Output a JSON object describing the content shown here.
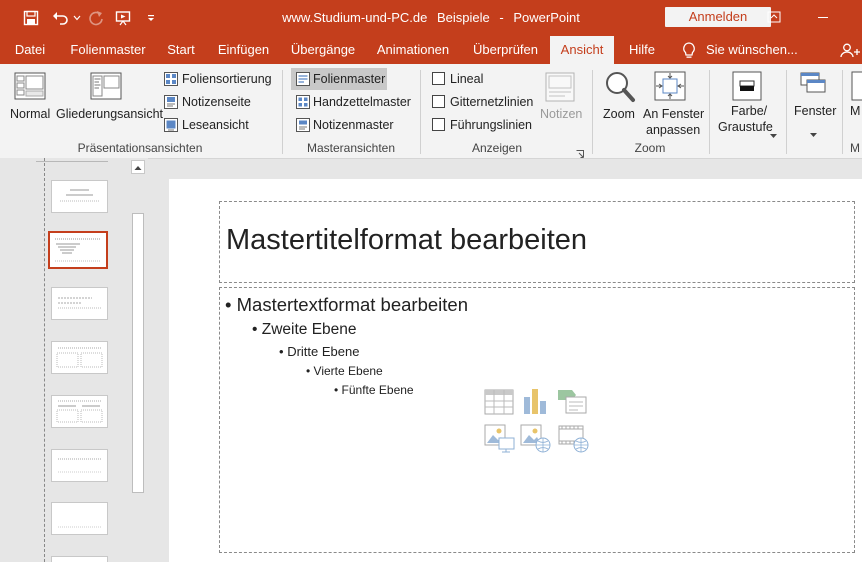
{
  "window": {
    "title_site": "www.Studium-und-PC.de",
    "title_doc": "Beispiele",
    "title_sep": "-",
    "title_app": "PowerPoint",
    "signin_label": "Anmelden"
  },
  "tabs": [
    "Datei",
    "Folienmaster",
    "Start",
    "Einfügen",
    "Übergänge",
    "Animationen",
    "Überprüfen",
    "Ansicht",
    "Hilfe"
  ],
  "active_tab": "Ansicht",
  "tell_me": "Sie wünschen...",
  "ribbon": {
    "presentation_views": {
      "group_label": "Präsentationsansichten",
      "normal": "Normal",
      "outline": "Gliederungsansicht",
      "slide_sorter": "Foliensortierung",
      "notes_page": "Notizenseite",
      "reading_view": "Leseansicht"
    },
    "master_views": {
      "group_label": "Masteransichten",
      "slide_master": "Folienmaster",
      "handout_master": "Handzettelmaster",
      "notes_master": "Notizenmaster"
    },
    "show": {
      "group_label": "Anzeigen",
      "ruler": "Lineal",
      "gridlines": "Gitternetzlinien",
      "guides": "Führungslinien",
      "notes": "Notizen"
    },
    "zoom": {
      "group_label": "Zoom",
      "zoom": "Zoom",
      "fit_line1": "An Fenster",
      "fit_line2": "anpassen"
    },
    "color": {
      "line1": "Farbe/",
      "line2": "Graustufe"
    },
    "window": {
      "label": "Fenster"
    }
  },
  "slide": {
    "title": "Mastertitelformat bearbeiten",
    "level1": "Mastertextformat bearbeiten",
    "level2": "Zweite Ebene",
    "level3": "Dritte Ebene",
    "level4": "Vierte Ebene",
    "level5": "Fünfte Ebene",
    "bullet": "•"
  },
  "colors": {
    "accent": "#c43e1c",
    "ribbon_bg": "#f3f3f3",
    "workspace_bg": "#e6e6e6"
  }
}
